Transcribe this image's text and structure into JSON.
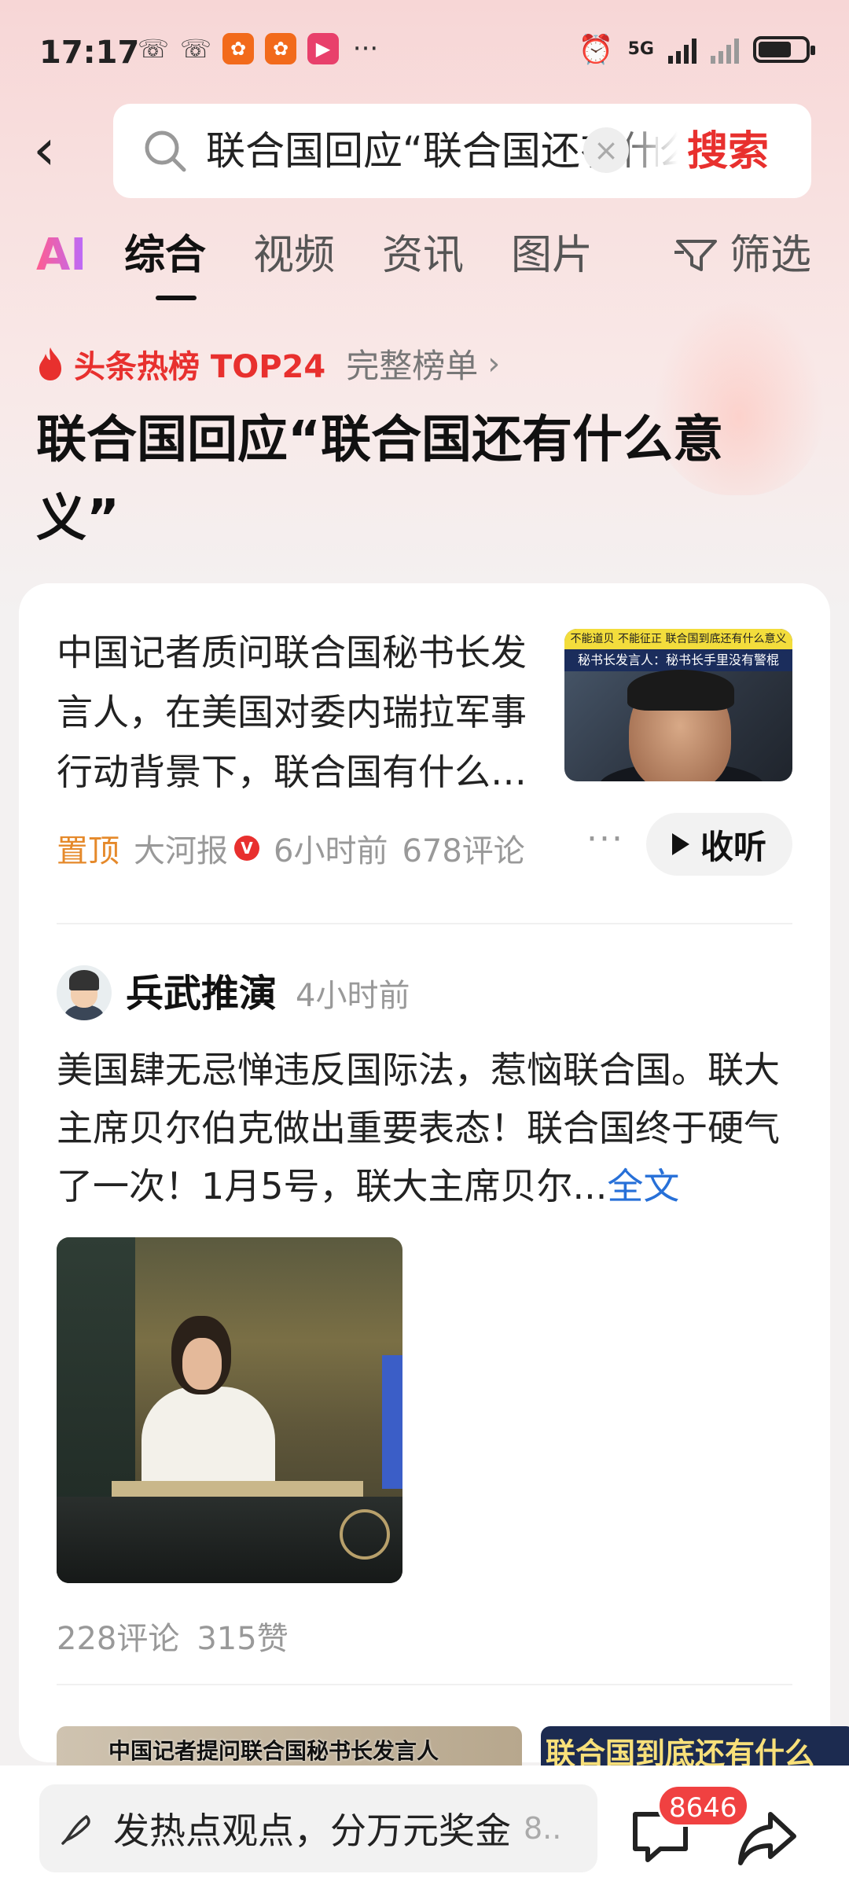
{
  "status_bar": {
    "time": "17:17",
    "network": "5G",
    "icons": [
      "missed-call-icon",
      "missed-call-icon",
      "app-icon",
      "app-icon",
      "video-app-icon",
      "more-dots-icon",
      "alarm-icon",
      "signal-icon",
      "signal-icon",
      "battery-icon"
    ]
  },
  "search": {
    "query": "联合国回应“联合国还有什么意义”",
    "button_label": "搜索"
  },
  "tabs": [
    {
      "label": "AI"
    },
    {
      "label": "综合",
      "active": true
    },
    {
      "label": "视频"
    },
    {
      "label": "资讯"
    },
    {
      "label": "图片"
    },
    {
      "label": "筛选"
    }
  ],
  "hot": {
    "rank_label": "头条热榜 TOP24",
    "full_list_label": "完整榜单",
    "headline": "联合国回应“联合国还有什么意义”"
  },
  "article1": {
    "text": "中国记者质问联合国秘书长发言人，在美国对委内瑞拉军事行动背景下，联合国有什么意义",
    "thumb_caption_top": "不能道贝 不能征正 联合国到底还有什么意义",
    "thumb_caption_bottom": "秘书长发言人：秘书长手里没有警棍",
    "pinned_label": "置顶",
    "source": "大河报",
    "verified_label": "V",
    "time": "6小时前",
    "comments": "678评论",
    "more": "···",
    "listen_label": "收听"
  },
  "post2": {
    "author": "兵武推演",
    "time": "4小时前",
    "body": "美国肆无忌惮违反国际法，惹恼联合国。联大主席贝尔伯克做出重要表态！联合国终于硬气了一次！1月5号，联大主席贝尔",
    "ellipsis": "...",
    "full_text_label": "全文",
    "comments": "228评论",
    "likes": "315赞"
  },
  "next_thumbs": {
    "a": "中国记者提问联合国秘书长发言人",
    "b": "联合国到底还有什么"
  },
  "bottom_bar": {
    "comment_placeholder": "发热点观点，分万元奖金",
    "comment_suffix": "8..",
    "comment_count": "8646"
  },
  "colors": {
    "accent_red": "#e8302e",
    "pinned_orange": "#e5892a",
    "link_blue": "#2770d8"
  }
}
